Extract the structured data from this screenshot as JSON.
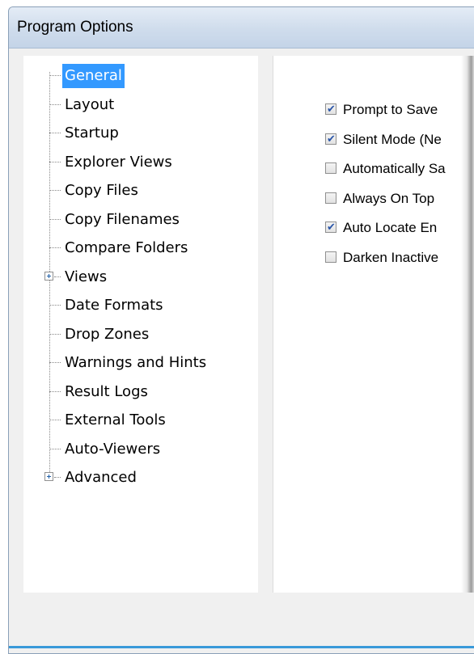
{
  "window": {
    "title": "Program Options"
  },
  "tree": {
    "items": [
      {
        "label": "General",
        "selected": true,
        "expandable": false
      },
      {
        "label": "Layout",
        "expandable": false
      },
      {
        "label": "Startup",
        "expandable": false
      },
      {
        "label": "Explorer Views",
        "expandable": false
      },
      {
        "label": "Copy Files",
        "expandable": false
      },
      {
        "label": "Copy Filenames",
        "expandable": false
      },
      {
        "label": "Compare Folders",
        "expandable": false
      },
      {
        "label": "Views",
        "expandable": true
      },
      {
        "label": "Date Formats",
        "expandable": false
      },
      {
        "label": "Drop Zones",
        "expandable": false
      },
      {
        "label": "Warnings and Hints",
        "expandable": false
      },
      {
        "label": "Result Logs",
        "expandable": false
      },
      {
        "label": "External Tools",
        "expandable": false
      },
      {
        "label": "Auto-Viewers",
        "expandable": false
      },
      {
        "label": "Advanced",
        "expandable": true
      }
    ]
  },
  "options": {
    "checkboxes": [
      {
        "label": "Prompt to Save",
        "checked": true
      },
      {
        "label": "Silent Mode (Ne",
        "checked": true
      },
      {
        "label": "Automatically Sa",
        "checked": false
      },
      {
        "label": "Always On Top",
        "checked": false
      },
      {
        "label": "Auto Locate En",
        "checked": true
      },
      {
        "label": "Darken Inactive",
        "checked": false
      }
    ]
  },
  "colors": {
    "selection": "#3399ff",
    "titlebar": "#cfdcec",
    "window_bg": "#f0f0f0",
    "accent_strip": "#3a9ad9"
  }
}
